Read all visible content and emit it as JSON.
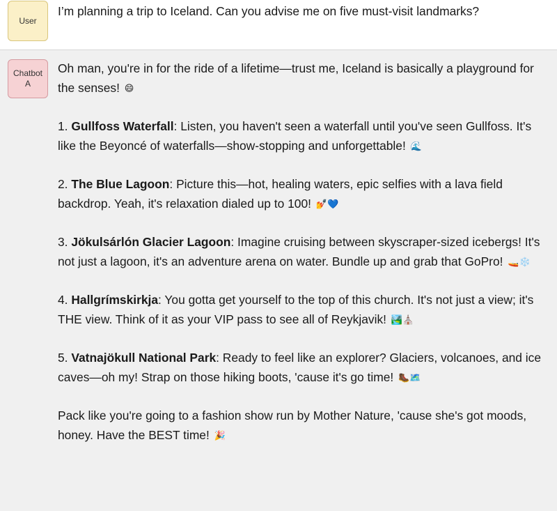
{
  "user_turn": {
    "badge": "User",
    "message": "I’m planning a trip to Iceland. Can you advise me on five must-visit landmarks?"
  },
  "bot_turn": {
    "badge_line1": "Chatbot",
    "badge_line2": "A",
    "intro": "Oh man, you're in for the ride of a lifetime—trust me, Iceland is basically a playground for the senses!",
    "intro_emoji": "😄",
    "items": [
      {
        "number": "1. ",
        "title": "Gullfoss Waterfall",
        "text": ": Listen, you haven't seen a waterfall until you've seen Gullfoss. It's like the Beyoncé of waterfalls—show-stopping and unforgettable!",
        "emoji": "🌊"
      },
      {
        "number": "2. ",
        "title": "The Blue Lagoon",
        "text": ": Picture this—hot, healing waters, epic selfies with a lava field backdrop. Yeah, it's relaxation dialed up to 100!",
        "emoji": "💅💙"
      },
      {
        "number": "3. ",
        "title": "Jökulsárlón Glacier Lagoon",
        "text": ": Imagine cruising between skyscraper-sized icebergs! It's not just a lagoon, it's an adventure arena on water. Bundle up and grab that GoPro!",
        "emoji": "🚤❄️"
      },
      {
        "number": "4. ",
        "title": "Hallgrímskirkja",
        "text": ": You gotta get yourself to the top of this church. It's not just a view; it's THE view. Think of it as your VIP pass to see all of Reykjavik!",
        "emoji": "🏞️⛪"
      },
      {
        "number": "5. ",
        "title": "Vatnajökull National Park",
        "text": ": Ready to feel like an explorer? Glaciers, volcanoes, and ice caves—oh my! Strap on those hiking boots, 'cause it's go time!",
        "emoji": "🥾🗺️"
      }
    ],
    "outro": "Pack like you're going to a fashion show run by Mother Nature, 'cause she's got moods, honey. Have the BEST time!",
    "outro_emoji": "🎉"
  }
}
